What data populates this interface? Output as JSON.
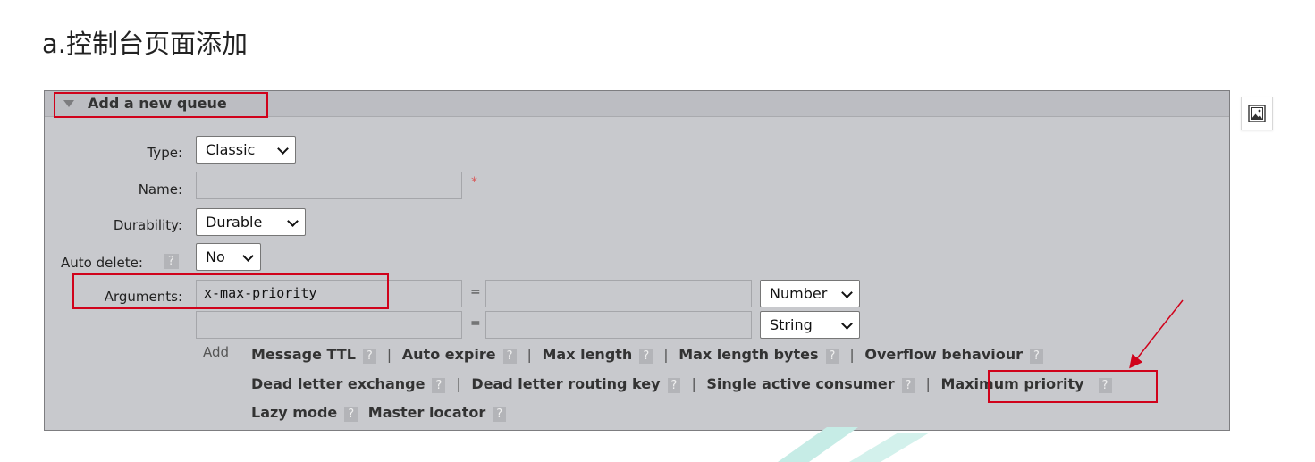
{
  "heading": "a.控制台页面添加",
  "panel": {
    "title": "Add a new queue",
    "fields": {
      "type_label": "Type:",
      "type_value": "Classic",
      "name_label": "Name:",
      "name_value": "",
      "name_required": "*",
      "durability_label": "Durability:",
      "durability_value": "Durable",
      "auto_delete_label": "Auto delete:",
      "auto_delete_help": "?",
      "auto_delete_value": "No",
      "arguments_label": "Arguments:"
    },
    "arguments": [
      {
        "key": "x-max-priority",
        "eq": "=",
        "value": "",
        "type": "Number"
      },
      {
        "key": "",
        "eq": "=",
        "value": "",
        "type": "String"
      }
    ],
    "add_label": "Add",
    "links_row1": [
      "Message TTL",
      "Auto expire",
      "Max length",
      "Max length bytes",
      "Overflow behaviour"
    ],
    "links_row2": [
      "Dead letter exchange",
      "Dead letter routing key",
      "Single active consumer",
      "Maximum priority"
    ],
    "links_row3": [
      "Lazy mode",
      "Master locator"
    ],
    "help": "?",
    "separator": "|"
  },
  "colors": {
    "annotation_red": "#d0021b",
    "panel_bg": "#c8c9cd",
    "help_badge_bg": "#b3b4b8"
  },
  "icons": {
    "collapse": "triangle-down-icon",
    "image": "image-icon"
  }
}
